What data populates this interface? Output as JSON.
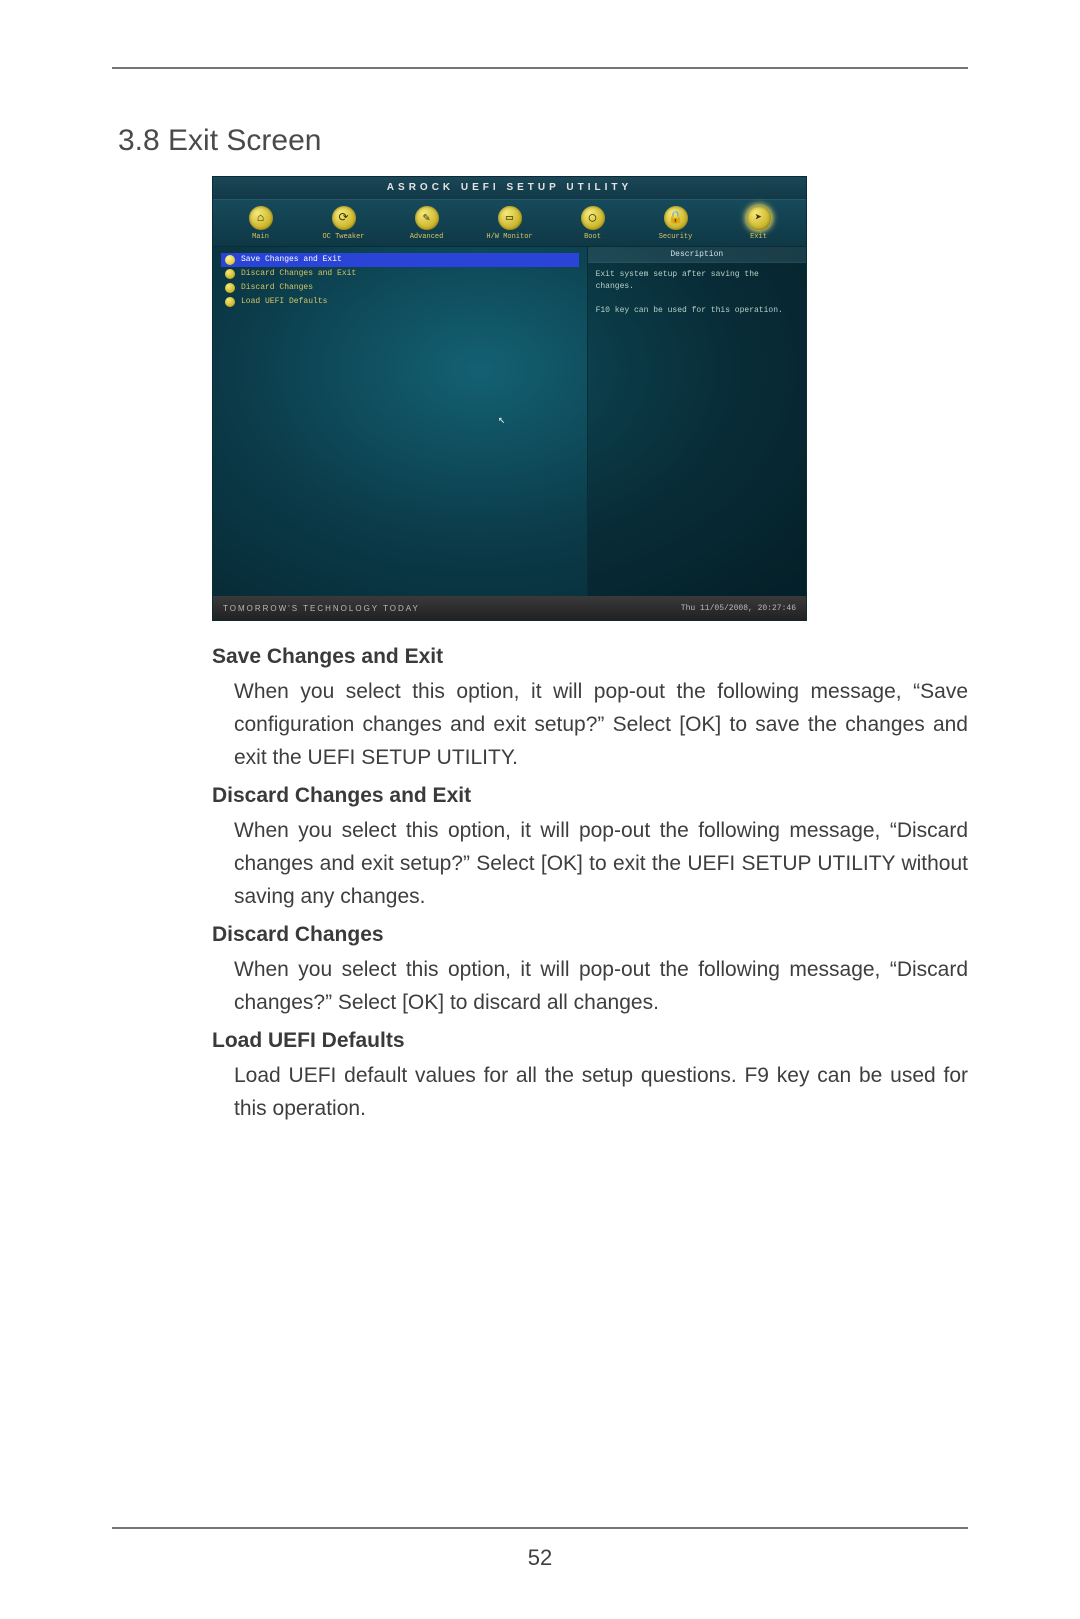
{
  "page": {
    "number": "52"
  },
  "heading": "3.8  Exit Screen",
  "shot": {
    "title": "ASROCK UEFI SETUP UTILITY",
    "tabs": [
      {
        "label": "Main",
        "glyph": "⌂"
      },
      {
        "label": "OC Tweaker",
        "glyph": "⟳"
      },
      {
        "label": "Advanced",
        "glyph": "✎"
      },
      {
        "label": "H/W Monitor",
        "glyph": "▭"
      },
      {
        "label": "Boot",
        "glyph": "◯"
      },
      {
        "label": "Security",
        "glyph": "🔒"
      },
      {
        "label": "Exit",
        "glyph": "➤"
      }
    ],
    "menu": [
      "Save Changes and Exit",
      "Discard Changes and Exit",
      "Discard Changes",
      "Load UEFI Defaults"
    ],
    "desc_header": "Description",
    "desc_line1": "Exit system setup after saving the changes.",
    "desc_line2": "F10 key can be used for this operation.",
    "footer_left": "TOMORROW'S TECHNOLOGY TODAY",
    "footer_right": "Thu 11/05/2008, 20:27:46"
  },
  "defs": [
    {
      "term": "Save Changes and Exit",
      "para": "When you select this option, it will pop-out the following message, “Save configuration changes and exit setup?” Select [OK] to save the changes and exit the UEFI SETUP UTILITY."
    },
    {
      "term": "Discard Changes and Exit",
      "para": "When you select this option, it will pop-out the following message, “Discard changes and exit setup?” Select [OK] to exit the UEFI SETUP UTILITY without saving any changes."
    },
    {
      "term": "Discard Changes",
      "para": "When you select this option, it will pop-out the following message, “Discard changes?” Select [OK] to discard all changes."
    },
    {
      "term": "Load UEFI Defaults",
      "para": "Load UEFI default values for all the setup questions. F9 key can be used for this operation."
    }
  ]
}
